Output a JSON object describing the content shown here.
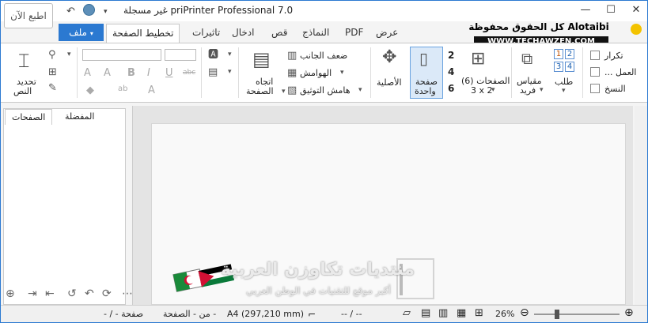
{
  "titlebar": {
    "title": "غير مسجلة priPrinter Professional 7.0",
    "print_now": "اطبع الآن",
    "minimize_icon": "minimize-icon",
    "maximize_icon": "maximize-icon",
    "close_icon": "close-icon"
  },
  "watermark_top": {
    "line1": "كل الحقوق محفوظة Alotaibi",
    "line2": "WWW.TECHAWZEN.COM"
  },
  "tabs": {
    "file": "ملف",
    "items": [
      "تخطيط الصفحة",
      "تاثيرات",
      "ادخال",
      "قص",
      "النماذج",
      "PDF",
      "عرض"
    ]
  },
  "ribbon": {
    "select_text_1": "تحديد",
    "select_text_2": "النص",
    "fit_width": "ضعف الجانب",
    "margins": "الهوامش",
    "binding_margin": "هامش التوثيق",
    "orientation_1": "اتجاه",
    "orientation_2": "الصفحة",
    "original": "الأصلية",
    "single_page_1": "صفحة",
    "single_page_2": "واحدة",
    "num_2": "2",
    "num_4": "4",
    "num_6": "6",
    "pages_6_1": "(الصفحات (6",
    "pages_6_2": "3 x 2",
    "scale_1": "مقياس",
    "scale_2": "فريد",
    "fold": "طلب",
    "n1": "1",
    "n2": "2",
    "n3": "3",
    "n4": "4",
    "repeat": "تكرار",
    "work": "... العمل",
    "copies": "النسخ"
  },
  "left_panel": {
    "tab_pages": "الصفحات",
    "tab_favorites": "المفضلة"
  },
  "watermark_bottom": {
    "title": "منتديات تكاوزن العربية",
    "subtitle": "أكبر موقع للتقنيات في الوطن العربي"
  },
  "status": {
    "page_of": "- / - صفحة",
    "from_page": "من - الصفحة -",
    "paper": "A4 (297,210 mm)",
    "coords": "-- / --",
    "zoom": "26%"
  }
}
